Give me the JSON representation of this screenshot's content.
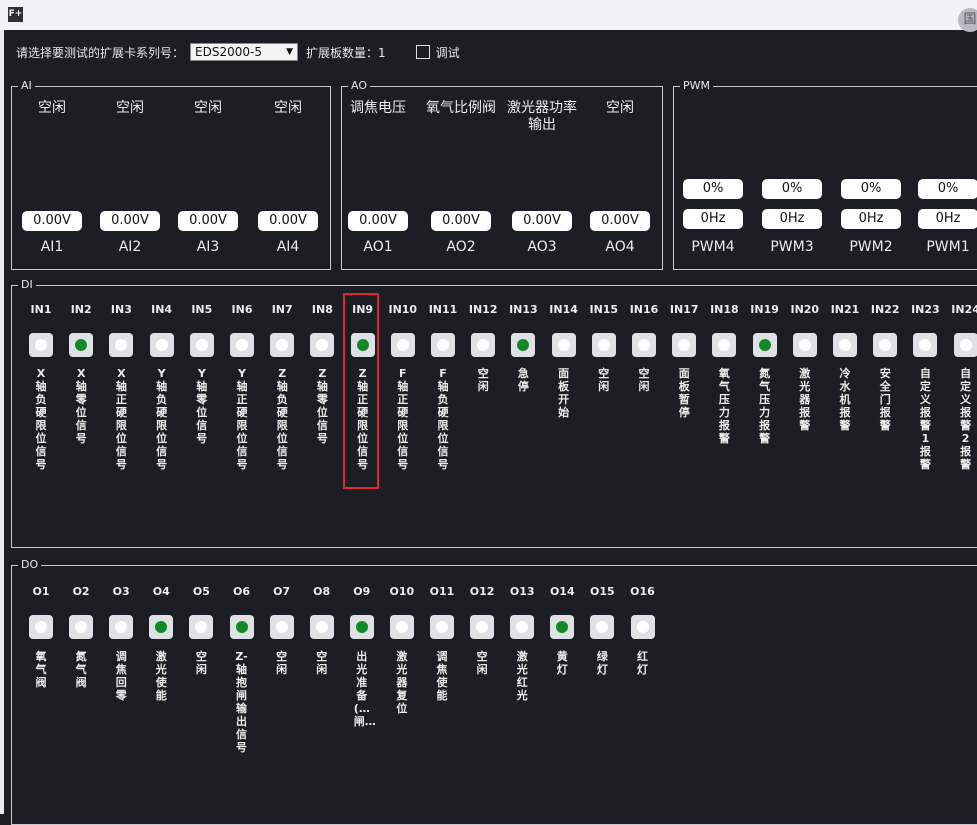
{
  "window": {
    "icon_label": "F+",
    "corner_label": "国"
  },
  "topbar": {
    "prompt": "请选择要测试的扩展卡系列号：",
    "select_value": "EDS2000-5",
    "count_label": "扩展板数量：1",
    "debug_label": "调试"
  },
  "ai": {
    "title": "AI",
    "channels": [
      {
        "name": "空闲",
        "value": "0.00V",
        "label": "AI1"
      },
      {
        "name": "空闲",
        "value": "0.00V",
        "label": "AI2"
      },
      {
        "name": "空闲",
        "value": "0.00V",
        "label": "AI3"
      },
      {
        "name": "空闲",
        "value": "0.00V",
        "label": "AI4"
      }
    ]
  },
  "ao": {
    "title": "AO",
    "channels": [
      {
        "name": "调焦电压",
        "value": "0.00V",
        "label": "AO1"
      },
      {
        "name": "氧气比例阀",
        "value": "0.00V",
        "label": "AO2"
      },
      {
        "name": "激光器功率输出",
        "value": "0.00V",
        "label": "AO3"
      },
      {
        "name": "空闲",
        "value": "0.00V",
        "label": "AO4"
      }
    ]
  },
  "pwm": {
    "title": "PWM",
    "channels": [
      {
        "duty": "0%",
        "freq": "0Hz",
        "label": "PWM4"
      },
      {
        "duty": "0%",
        "freq": "0Hz",
        "label": "PWM3"
      },
      {
        "duty": "0%",
        "freq": "0Hz",
        "label": "PWM2"
      },
      {
        "duty": "0%",
        "freq": "0Hz",
        "label": "PWM1"
      }
    ]
  },
  "di": {
    "title": "DI",
    "items": [
      {
        "label": "IN1",
        "on": false,
        "desc": "X轴负硬限位信号"
      },
      {
        "label": "IN2",
        "on": true,
        "desc": "X轴零位信号"
      },
      {
        "label": "IN3",
        "on": false,
        "desc": "X轴正硬限位信号"
      },
      {
        "label": "IN4",
        "on": false,
        "desc": "Y轴负硬限位信号"
      },
      {
        "label": "IN5",
        "on": false,
        "desc": "Y轴零位信号"
      },
      {
        "label": "IN6",
        "on": false,
        "desc": "Y轴正硬限位信号"
      },
      {
        "label": "IN7",
        "on": false,
        "desc": "Z轴负硬限位信号"
      },
      {
        "label": "IN8",
        "on": false,
        "desc": "Z轴零位信号"
      },
      {
        "label": "IN9",
        "on": true,
        "desc": "Z轴正硬限位信号"
      },
      {
        "label": "IN10",
        "on": false,
        "desc": "F轴正硬限位信号"
      },
      {
        "label": "IN11",
        "on": false,
        "desc": "F轴负硬限位信号"
      },
      {
        "label": "IN12",
        "on": false,
        "desc": "空闲"
      },
      {
        "label": "IN13",
        "on": true,
        "desc": "急停"
      },
      {
        "label": "IN14",
        "on": false,
        "desc": "面板开始"
      },
      {
        "label": "IN15",
        "on": false,
        "desc": "空闲"
      },
      {
        "label": "IN16",
        "on": false,
        "desc": "空闲"
      },
      {
        "label": "IN17",
        "on": false,
        "desc": "面板暂停"
      },
      {
        "label": "IN18",
        "on": false,
        "desc": "氧气压力报警"
      },
      {
        "label": "IN19",
        "on": true,
        "desc": "氮气压力报警"
      },
      {
        "label": "IN20",
        "on": false,
        "desc": "激光器报警"
      },
      {
        "label": "IN21",
        "on": false,
        "desc": "冷水机报警"
      },
      {
        "label": "IN22",
        "on": false,
        "desc": "安全门报警"
      },
      {
        "label": "IN23",
        "on": false,
        "desc": "自定义报警1报警"
      },
      {
        "label": "IN24",
        "on": false,
        "desc": "自定义报警2报警"
      }
    ]
  },
  "do": {
    "title": "DO",
    "items": [
      {
        "label": "O1",
        "on": false,
        "desc": "氧气阀"
      },
      {
        "label": "O2",
        "on": false,
        "desc": "氮气阀"
      },
      {
        "label": "O3",
        "on": false,
        "desc": "调焦回零"
      },
      {
        "label": "O4",
        "on": true,
        "desc": "激光使能"
      },
      {
        "label": "O5",
        "on": false,
        "desc": "空闲"
      },
      {
        "label": "O6",
        "on": true,
        "desc": "Z-轴抱闸输出信号"
      },
      {
        "label": "O7",
        "on": false,
        "desc": "空闲"
      },
      {
        "label": "O8",
        "on": false,
        "desc": "空闲"
      },
      {
        "label": "O9",
        "on": true,
        "desc": "出光准备(…闸…"
      },
      {
        "label": "O10",
        "on": false,
        "desc": "激光器复位"
      },
      {
        "label": "O11",
        "on": false,
        "desc": "调焦使能"
      },
      {
        "label": "O12",
        "on": false,
        "desc": "空闲"
      },
      {
        "label": "O13",
        "on": false,
        "desc": "激光红光"
      },
      {
        "label": "O14",
        "on": true,
        "desc": "黄灯"
      },
      {
        "label": "O15",
        "on": false,
        "desc": "绿灯"
      },
      {
        "label": "O16",
        "on": false,
        "desc": "红灯"
      }
    ]
  }
}
